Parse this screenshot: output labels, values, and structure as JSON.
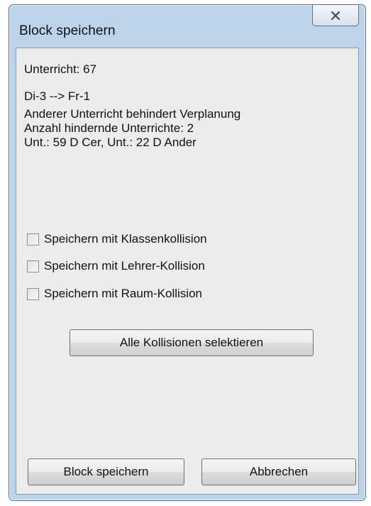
{
  "window": {
    "title": "Block speichern",
    "close_icon": "close-icon"
  },
  "info": {
    "unterricht": "Unterricht: 67",
    "period": "Di-3 --> Fr-1",
    "reason": "Anderer Unterricht behindert Verplanung",
    "count": "Anzahl hindernde Unterrichte: 2",
    "lessons": "Unt.: 59 D Cer, Unt.: 22 D Ander"
  },
  "options": [
    {
      "label": "Speichern mit Klassenkollision",
      "checked": false
    },
    {
      "label": "Speichern mit Lehrer-Kollision",
      "checked": false
    },
    {
      "label": "Speichern mit Raum-Kollision",
      "checked": false
    }
  ],
  "buttons": {
    "select_all": "Alle Kollisionen selektieren",
    "save": "Block speichern",
    "cancel": "Abbrechen"
  }
}
